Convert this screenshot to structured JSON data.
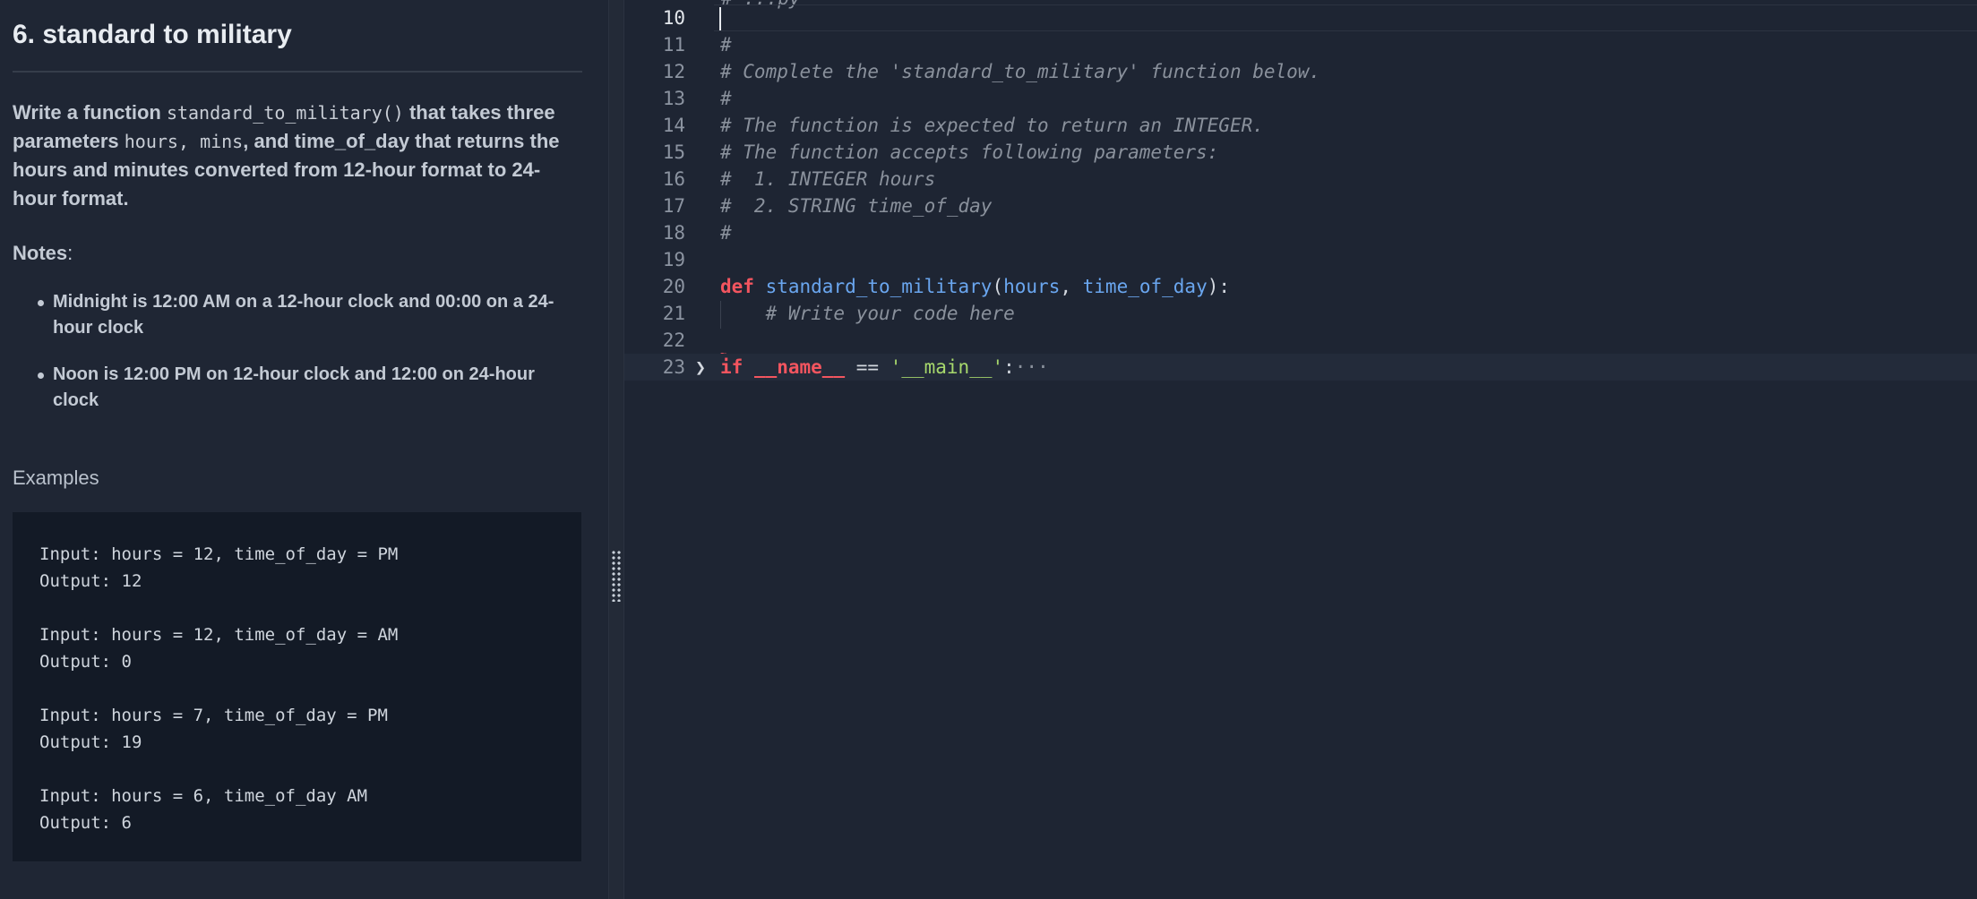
{
  "problem": {
    "title": "6. standard to military",
    "description": {
      "p1": "Write a function ",
      "code_fn": "standard_to_military()",
      "p2": " that takes three parameters ",
      "code_hours": "hours",
      "sep": ", ",
      "code_mins": "mins",
      "p3": ", and time_of_day that returns the hours and minutes converted from 12-hour format to 24-hour format."
    },
    "notes_heading": "Notes",
    "notes_colon": ":",
    "notes": [
      "Midnight is 12:00 AM on a 12-hour clock and 00:00 on a 24-hour clock",
      "Noon is 12:00 PM on 12-hour clock and 12:00 on 24-hour clock"
    ],
    "examples_heading": "Examples",
    "examples": [
      {
        "input": "Input: hours = 12, time_of_day = PM",
        "output": "Output: 12"
      },
      {
        "input": "Input: hours = 12, time_of_day = AM",
        "output": "Output: 0"
      },
      {
        "input": "Input: hours = 7, time_of_day = PM",
        "output": "Output: 19"
      },
      {
        "input": "Input: hours = 6, time_of_day AM",
        "output": "Output: 6"
      }
    ]
  },
  "editor": {
    "cut_top_text": "# ...py",
    "lines": {
      "n10": "10",
      "n11": "11",
      "n12": "12",
      "n13": "13",
      "n14": "14",
      "n15": "15",
      "n16": "16",
      "n17": "17",
      "n18": "18",
      "n19": "19",
      "n20": "20",
      "n21": "21",
      "n22": "22",
      "n23": "23"
    },
    "code": {
      "l11": "#",
      "l12": "# Complete the 'standard_to_military' function below.",
      "l13": "#",
      "l14": "# The function is expected to return an INTEGER.",
      "l15": "# The function accepts following parameters:",
      "l16": "#  1. INTEGER hours",
      "l17": "#  2. STRING time_of_day",
      "l18": "#",
      "l20_def": "def",
      "l20_fn": "standard_to_military",
      "l20_open": "(",
      "l20_p1": "hours",
      "l20_comma": ", ",
      "l20_p2": "time_of_day",
      "l20_close": "):",
      "l21": "    # Write your code here",
      "l23_if": "if",
      "l23_name": "__name__",
      "l23_eq": " == ",
      "l23_str": "'__main__'",
      "l23_colon": ":",
      "l23_ellipsis": "···",
      "fold_glyph": "❯"
    }
  }
}
